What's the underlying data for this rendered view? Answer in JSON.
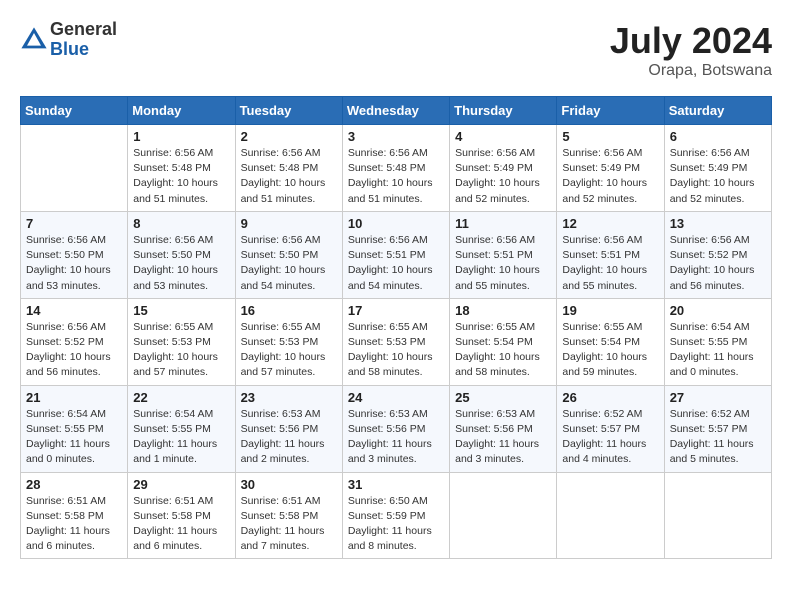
{
  "logo": {
    "general": "General",
    "blue": "Blue"
  },
  "title": {
    "month_year": "July 2024",
    "location": "Orapa, Botswana"
  },
  "days_of_week": [
    "Sunday",
    "Monday",
    "Tuesday",
    "Wednesday",
    "Thursday",
    "Friday",
    "Saturday"
  ],
  "weeks": [
    [
      {
        "day": "",
        "info": ""
      },
      {
        "day": "1",
        "info": "Sunrise: 6:56 AM\nSunset: 5:48 PM\nDaylight: 10 hours\nand 51 minutes."
      },
      {
        "day": "2",
        "info": "Sunrise: 6:56 AM\nSunset: 5:48 PM\nDaylight: 10 hours\nand 51 minutes."
      },
      {
        "day": "3",
        "info": "Sunrise: 6:56 AM\nSunset: 5:48 PM\nDaylight: 10 hours\nand 51 minutes."
      },
      {
        "day": "4",
        "info": "Sunrise: 6:56 AM\nSunset: 5:49 PM\nDaylight: 10 hours\nand 52 minutes."
      },
      {
        "day": "5",
        "info": "Sunrise: 6:56 AM\nSunset: 5:49 PM\nDaylight: 10 hours\nand 52 minutes."
      },
      {
        "day": "6",
        "info": "Sunrise: 6:56 AM\nSunset: 5:49 PM\nDaylight: 10 hours\nand 52 minutes."
      }
    ],
    [
      {
        "day": "7",
        "info": "Sunrise: 6:56 AM\nSunset: 5:50 PM\nDaylight: 10 hours\nand 53 minutes."
      },
      {
        "day": "8",
        "info": "Sunrise: 6:56 AM\nSunset: 5:50 PM\nDaylight: 10 hours\nand 53 minutes."
      },
      {
        "day": "9",
        "info": "Sunrise: 6:56 AM\nSunset: 5:50 PM\nDaylight: 10 hours\nand 54 minutes."
      },
      {
        "day": "10",
        "info": "Sunrise: 6:56 AM\nSunset: 5:51 PM\nDaylight: 10 hours\nand 54 minutes."
      },
      {
        "day": "11",
        "info": "Sunrise: 6:56 AM\nSunset: 5:51 PM\nDaylight: 10 hours\nand 55 minutes."
      },
      {
        "day": "12",
        "info": "Sunrise: 6:56 AM\nSunset: 5:51 PM\nDaylight: 10 hours\nand 55 minutes."
      },
      {
        "day": "13",
        "info": "Sunrise: 6:56 AM\nSunset: 5:52 PM\nDaylight: 10 hours\nand 56 minutes."
      }
    ],
    [
      {
        "day": "14",
        "info": "Sunrise: 6:56 AM\nSunset: 5:52 PM\nDaylight: 10 hours\nand 56 minutes."
      },
      {
        "day": "15",
        "info": "Sunrise: 6:55 AM\nSunset: 5:53 PM\nDaylight: 10 hours\nand 57 minutes."
      },
      {
        "day": "16",
        "info": "Sunrise: 6:55 AM\nSunset: 5:53 PM\nDaylight: 10 hours\nand 57 minutes."
      },
      {
        "day": "17",
        "info": "Sunrise: 6:55 AM\nSunset: 5:53 PM\nDaylight: 10 hours\nand 58 minutes."
      },
      {
        "day": "18",
        "info": "Sunrise: 6:55 AM\nSunset: 5:54 PM\nDaylight: 10 hours\nand 58 minutes."
      },
      {
        "day": "19",
        "info": "Sunrise: 6:55 AM\nSunset: 5:54 PM\nDaylight: 10 hours\nand 59 minutes."
      },
      {
        "day": "20",
        "info": "Sunrise: 6:54 AM\nSunset: 5:55 PM\nDaylight: 11 hours\nand 0 minutes."
      }
    ],
    [
      {
        "day": "21",
        "info": "Sunrise: 6:54 AM\nSunset: 5:55 PM\nDaylight: 11 hours\nand 0 minutes."
      },
      {
        "day": "22",
        "info": "Sunrise: 6:54 AM\nSunset: 5:55 PM\nDaylight: 11 hours\nand 1 minute."
      },
      {
        "day": "23",
        "info": "Sunrise: 6:53 AM\nSunset: 5:56 PM\nDaylight: 11 hours\nand 2 minutes."
      },
      {
        "day": "24",
        "info": "Sunrise: 6:53 AM\nSunset: 5:56 PM\nDaylight: 11 hours\nand 3 minutes."
      },
      {
        "day": "25",
        "info": "Sunrise: 6:53 AM\nSunset: 5:56 PM\nDaylight: 11 hours\nand 3 minutes."
      },
      {
        "day": "26",
        "info": "Sunrise: 6:52 AM\nSunset: 5:57 PM\nDaylight: 11 hours\nand 4 minutes."
      },
      {
        "day": "27",
        "info": "Sunrise: 6:52 AM\nSunset: 5:57 PM\nDaylight: 11 hours\nand 5 minutes."
      }
    ],
    [
      {
        "day": "28",
        "info": "Sunrise: 6:51 AM\nSunset: 5:58 PM\nDaylight: 11 hours\nand 6 minutes."
      },
      {
        "day": "29",
        "info": "Sunrise: 6:51 AM\nSunset: 5:58 PM\nDaylight: 11 hours\nand 6 minutes."
      },
      {
        "day": "30",
        "info": "Sunrise: 6:51 AM\nSunset: 5:58 PM\nDaylight: 11 hours\nand 7 minutes."
      },
      {
        "day": "31",
        "info": "Sunrise: 6:50 AM\nSunset: 5:59 PM\nDaylight: 11 hours\nand 8 minutes."
      },
      {
        "day": "",
        "info": ""
      },
      {
        "day": "",
        "info": ""
      },
      {
        "day": "",
        "info": ""
      }
    ]
  ]
}
